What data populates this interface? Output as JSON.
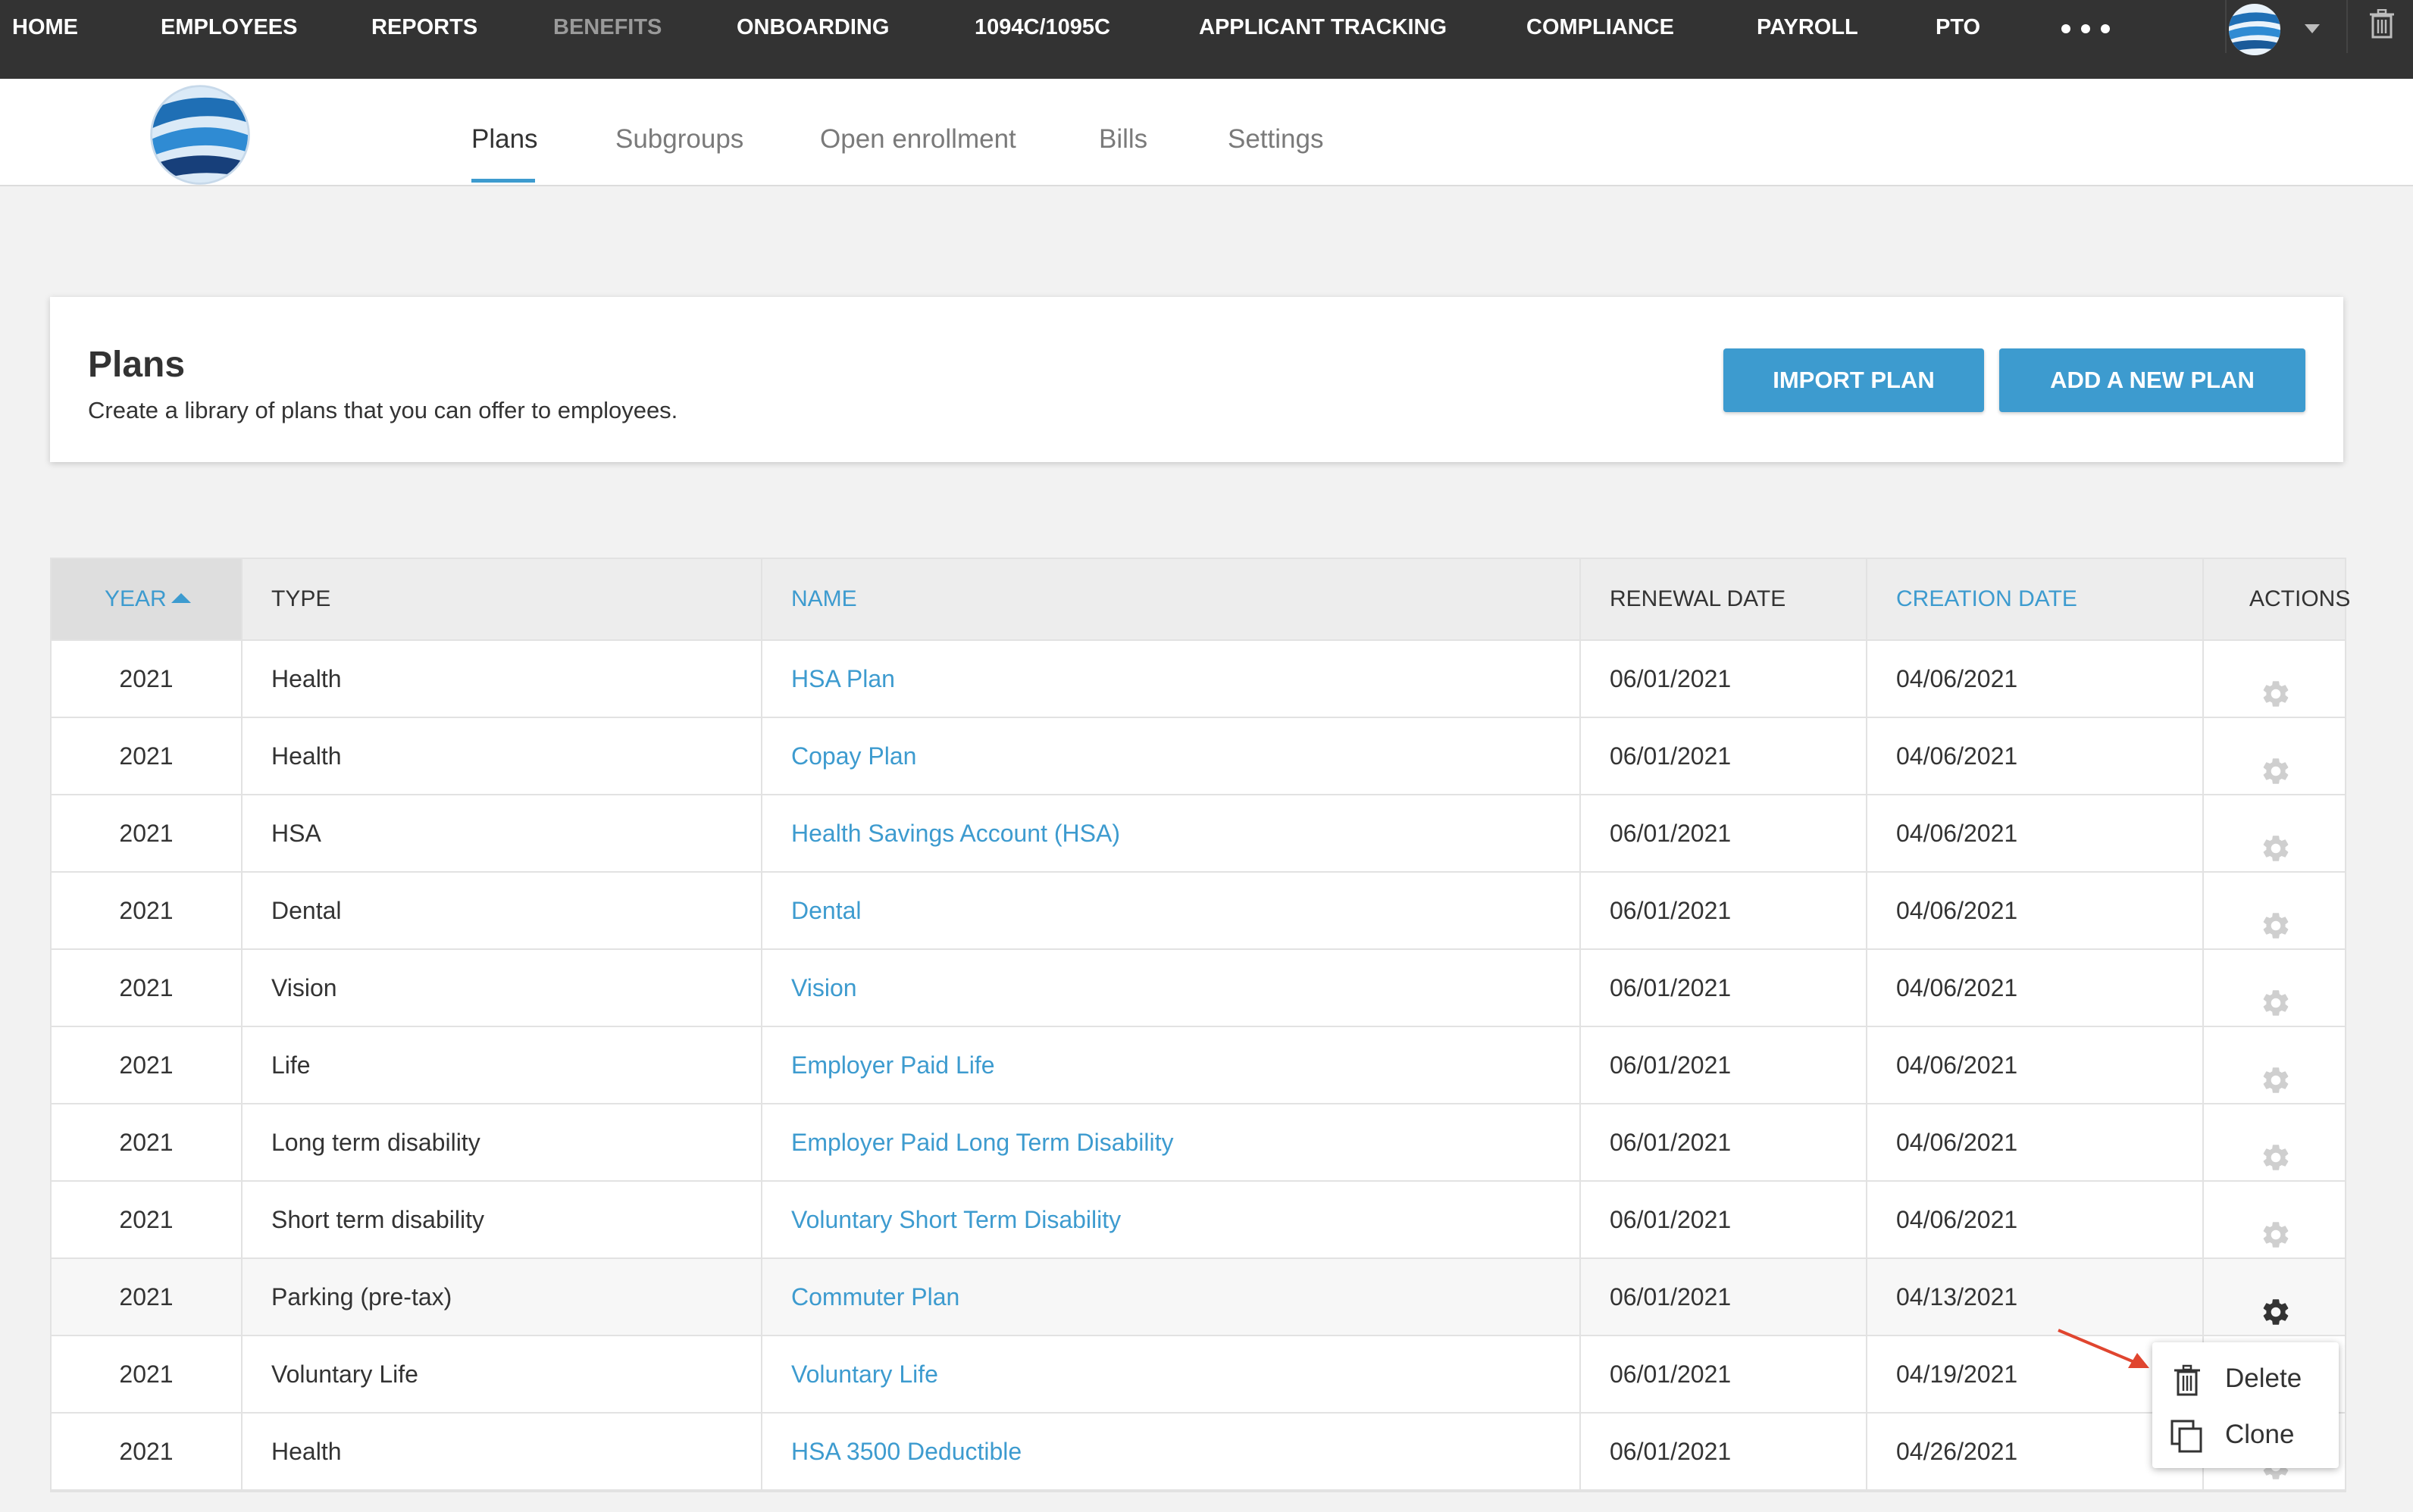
{
  "topnav": {
    "items": [
      "HOME",
      "EMPLOYEES",
      "REPORTS",
      "BENEFITS",
      "ONBOARDING",
      "1094C/1095C",
      "APPLICANT TRACKING",
      "COMPLIANCE",
      "PAYROLL",
      "PTO"
    ],
    "more_icon": "ellipsis-icon",
    "account_icon": "globe-logo-icon",
    "trash_icon": "trash-icon"
  },
  "tabs": [
    "Plans",
    "Subgroups",
    "Open enrollment",
    "Bills",
    "Settings"
  ],
  "card": {
    "title": "Plans",
    "subtitle": "Create a library of plans that you can offer to employees.",
    "import_label": "IMPORT PLAN",
    "add_label": "ADD A NEW PLAN"
  },
  "table": {
    "headers": {
      "year": "YEAR",
      "type": "TYPE",
      "name": "NAME",
      "renewal": "RENEWAL DATE",
      "creation": "CREATION DATE",
      "actions": "ACTIONS"
    },
    "rows": [
      {
        "year": "2021",
        "type": "Health",
        "name": "HSA Plan",
        "renewal": "06/01/2021",
        "creation": "04/06/2021"
      },
      {
        "year": "2021",
        "type": "Health",
        "name": "Copay Plan",
        "renewal": "06/01/2021",
        "creation": "04/06/2021"
      },
      {
        "year": "2021",
        "type": "HSA",
        "name": "Health Savings Account (HSA)",
        "renewal": "06/01/2021",
        "creation": "04/06/2021"
      },
      {
        "year": "2021",
        "type": "Dental",
        "name": "Dental",
        "renewal": "06/01/2021",
        "creation": "04/06/2021"
      },
      {
        "year": "2021",
        "type": "Vision",
        "name": "Vision",
        "renewal": "06/01/2021",
        "creation": "04/06/2021"
      },
      {
        "year": "2021",
        "type": "Life",
        "name": "Employer Paid Life",
        "renewal": "06/01/2021",
        "creation": "04/06/2021"
      },
      {
        "year": "2021",
        "type": "Long term disability",
        "name": "Employer Paid Long Term Disability",
        "renewal": "06/01/2021",
        "creation": "04/06/2021"
      },
      {
        "year": "2021",
        "type": "Short term disability",
        "name": "Voluntary Short Term Disability",
        "renewal": "06/01/2021",
        "creation": "04/06/2021"
      },
      {
        "year": "2021",
        "type": "Parking (pre-tax)",
        "name": "Commuter Plan",
        "renewal": "06/01/2021",
        "creation": "04/13/2021"
      },
      {
        "year": "2021",
        "type": "Voluntary Life",
        "name": "Voluntary Life",
        "renewal": "06/01/2021",
        "creation": "04/19/2021"
      },
      {
        "year": "2021",
        "type": "Health",
        "name": "HSA 3500 Deductible",
        "renewal": "06/01/2021",
        "creation": "04/26/2021"
      }
    ]
  },
  "action_menu": {
    "delete_label": "Delete",
    "clone_label": "Clone"
  },
  "colors": {
    "nav_bg": "#333333",
    "accent": "#3d9bcf",
    "page_bg": "#f2f2f2",
    "annotation_arrow": "#e0452f"
  }
}
